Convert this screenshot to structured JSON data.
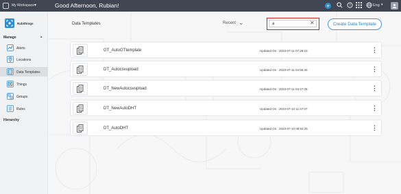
{
  "topbar": {
    "workspace_label": "My Workspace",
    "greeting": "Good Afternoon, Rubian!",
    "language": "Eng",
    "icons": [
      "workspace-icon",
      "add-icon",
      "search-icon",
      "help-icon",
      "apps-grid-icon",
      "globe-icon",
      "user-avatar-icon"
    ]
  },
  "sidebar": {
    "brand": "Rubithings",
    "manage_title": "Manage",
    "items": [
      {
        "label": "Alerts",
        "icon": "alert-icon"
      },
      {
        "label": "Locations",
        "icon": "location-icon"
      },
      {
        "label": "Data Templates",
        "icon": "template-icon",
        "active": true
      },
      {
        "label": "Things",
        "icon": "things-icon"
      },
      {
        "label": "Groups",
        "icon": "groups-icon"
      },
      {
        "label": "Rules",
        "icon": "rules-icon"
      }
    ],
    "hierarchy_title": "Hierarchy"
  },
  "main": {
    "title": "Data Templates",
    "sort_label": "Recent",
    "search_value": "a",
    "create_label": "Create Data Template",
    "rows": [
      {
        "name": "GT_AutoGTtemplate",
        "updated": "Updated On : 2023-07-11 07:28:23"
      },
      {
        "name": "DT_Autocsvupload",
        "updated": "Updated On : 2023-07-11 04:55:30"
      },
      {
        "name": "DT_NewAutocsvupload",
        "updated": "Updated On : 2023-07-11 04:47:05"
      },
      {
        "name": "DT_NewAutoDHT",
        "updated": "Updated On : 2023-07-10 11:47:07"
      },
      {
        "name": "DT_AutoDHT",
        "updated": "Updated On : 2023-07-10 09:53:25"
      }
    ]
  },
  "colors": {
    "topbar": "#3f4652",
    "accent": "#2f8ecf",
    "search_highlight": "#cc1f1f"
  }
}
